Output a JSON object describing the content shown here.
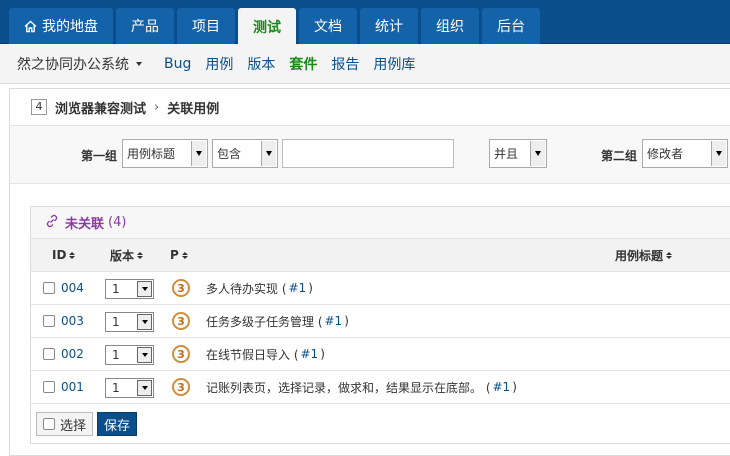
{
  "topnav": {
    "tabs": [
      {
        "label": "我的地盘",
        "icon": "home-icon"
      },
      {
        "label": "产品"
      },
      {
        "label": "项目"
      },
      {
        "label": "测试",
        "active": true
      },
      {
        "label": "文档"
      },
      {
        "label": "统计"
      },
      {
        "label": "组织"
      },
      {
        "label": "后台"
      }
    ]
  },
  "subnav": {
    "system_name": "然之协同办公系统",
    "items": [
      "Bug",
      "用例",
      "版本",
      "套件",
      "报告",
      "用例库"
    ],
    "active": "套件"
  },
  "breadcrumb": {
    "id": "4",
    "parent": "浏览器兼容测试",
    "separator": "›",
    "current": "关联用例"
  },
  "search": {
    "group1_label": "第一组",
    "group1_field": "用例标题",
    "group1_operator": "包含",
    "group1_value": "",
    "logic": "并且",
    "group2_label": "第二组",
    "group2_field": "修改者"
  },
  "panel": {
    "title": "未关联",
    "count": "(4)",
    "link_icon": "link-icon"
  },
  "table": {
    "headers": {
      "id": "ID",
      "version": "版本",
      "priority": "P",
      "title": "用例标题"
    },
    "rows": [
      {
        "id": "004",
        "version": "1",
        "priority": "3",
        "title": "多人待办实现 (",
        "ver": "#1",
        "close": ")"
      },
      {
        "id": "003",
        "version": "1",
        "priority": "3",
        "title": "任务多级子任务管理 (",
        "ver": "#1",
        "close": ")"
      },
      {
        "id": "002",
        "version": "1",
        "priority": "3",
        "title": "在线节假日导入 (",
        "ver": "#1",
        "close": ")"
      },
      {
        "id": "001",
        "version": "1",
        "priority": "3",
        "title": "记账列表页，选择记录，做求和，结果显示在底部。 (",
        "ver": "#1",
        "close": ")"
      }
    ]
  },
  "footer": {
    "select_label": "选择",
    "save_label": "保存"
  },
  "colors": {
    "nav_bg": "#0b4e8c",
    "tab_bg": "#1462a8",
    "active_green": "#1a8a1a",
    "link_blue": "#0b4e8c",
    "panel_title_purple": "#8a3aa6",
    "priority_orange": "#d28e3c"
  }
}
